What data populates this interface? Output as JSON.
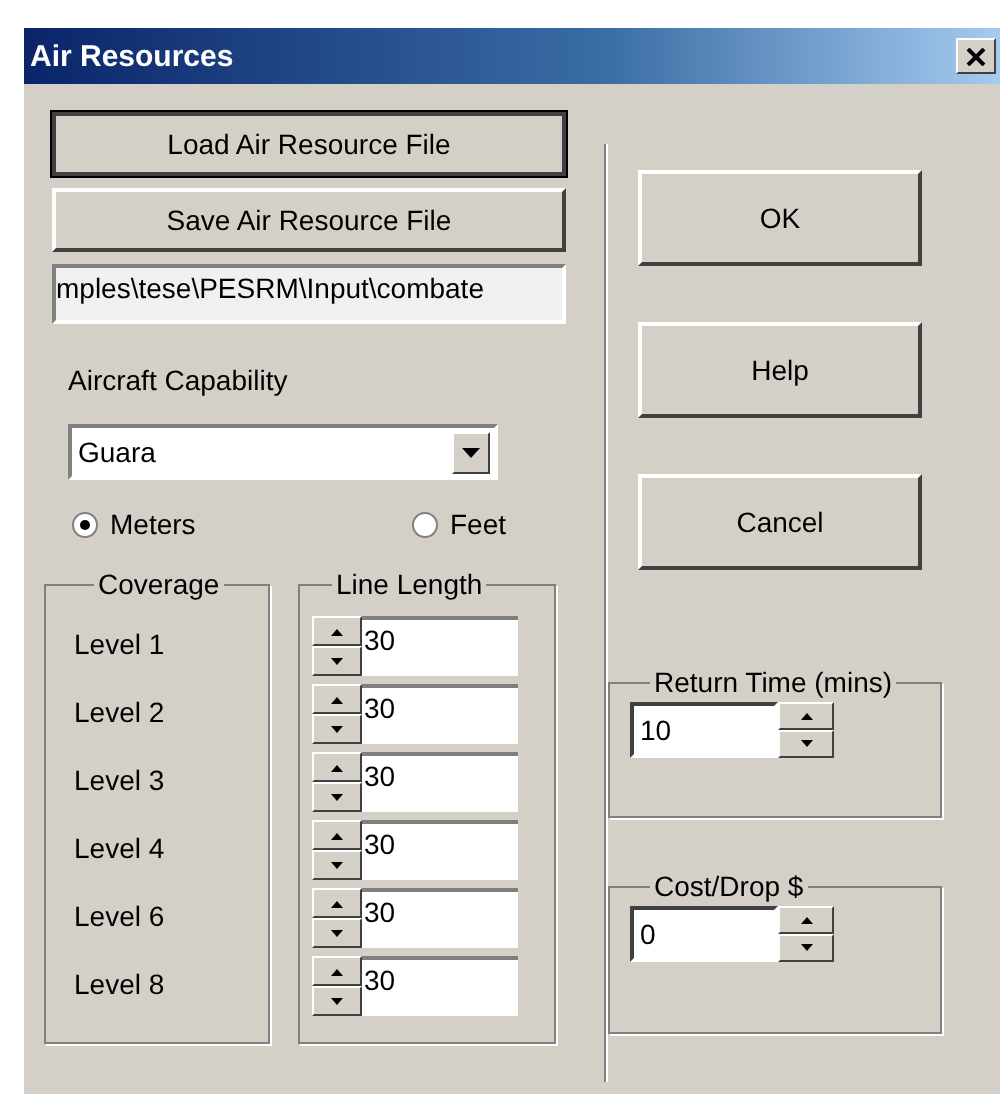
{
  "window": {
    "title": "Air Resources"
  },
  "file_buttons": [
    "Load Air Resource File",
    "Save Air Resource File"
  ],
  "file_path": "mples\\tese\\PESRM\\Input\\combate",
  "aircraft_capability": {
    "label": "Aircraft Capability",
    "value": "Guara"
  },
  "units": [
    {
      "label": "Meters",
      "selected": true
    },
    {
      "label": "Feet",
      "selected": false
    }
  ],
  "coverage": {
    "title": "Coverage",
    "levels": [
      "Level 1",
      "Level 2",
      "Level 3",
      "Level 4",
      "Level 6",
      "Level 8"
    ]
  },
  "line_length": {
    "title": "Line Length",
    "values": [
      "30",
      "30",
      "30",
      "30",
      "30",
      "30"
    ]
  },
  "action_buttons": [
    "OK",
    "Help",
    "Cancel"
  ],
  "return_time": {
    "title": "Return Time (mins)",
    "value": "10"
  },
  "cost_drop": {
    "title": "Cost/Drop $",
    "value": "0"
  }
}
